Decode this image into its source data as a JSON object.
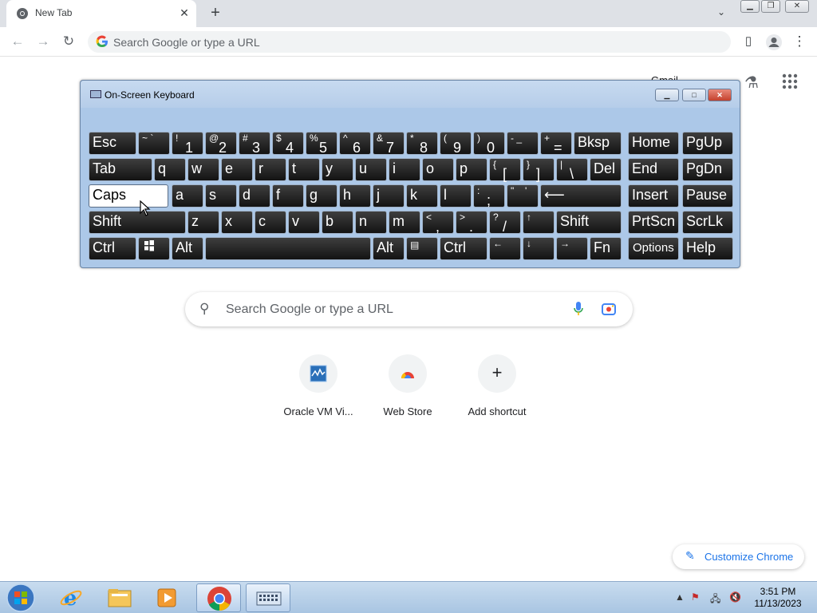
{
  "browser": {
    "tab_title": "New Tab",
    "tab_close": "✕",
    "new_tab": "+",
    "omnibox_placeholder": "Search Google or type a URL"
  },
  "osk": {
    "title": "On-Screen Keyboard",
    "keys": {
      "esc": "Esc",
      "tilde_s": "~ `",
      "n1_s": "!",
      "n1": "1",
      "n2_s": "@",
      "n2": "2",
      "n3_s": "#",
      "n3": "3",
      "n4_s": "$",
      "n4": "4",
      "n5_s": "%",
      "n5": "5",
      "n6_s": "^",
      "n6": "6",
      "n7_s": "&",
      "n7": "7",
      "n8_s": "*",
      "n8": "8",
      "n9_s": "(",
      "n9": "9",
      "n0_s": ")",
      "n0": "0",
      "minus_s": "- _",
      "plus_s": "+",
      "plus": "=",
      "bksp": "Bksp",
      "home": "Home",
      "pgup": "PgUp",
      "tab": "Tab",
      "q": "q",
      "w": "w",
      "e": "e",
      "r": "r",
      "t": "t",
      "y": "y",
      "u": "u",
      "i": "i",
      "o": "o",
      "p": "p",
      "lbr_s": "{",
      "lbr": "[",
      "rbr_s": "}",
      "rbr": "]",
      "bs_s": "|",
      "bs": "\\",
      "del": "Del",
      "end": "End",
      "pgdn": "PgDn",
      "caps": "Caps",
      "a": "a",
      "s": "s",
      "d": "d",
      "f": "f",
      "g": "g",
      "h": "h",
      "j": "j",
      "k": "k",
      "l": "l",
      "semi_s": ":",
      "semi": ";",
      "quote_s": "\"",
      "quote": "'",
      "enter": "⟵",
      "insert": "Insert",
      "pause": "Pause",
      "shift": "Shift",
      "z": "z",
      "x": "x",
      "c": "c",
      "v": "v",
      "b": "b",
      "n": "n",
      "m": "m",
      "comma_s": "<",
      "comma": ",",
      "period_s": ">",
      "period": ".",
      "slash_s": "?",
      "slash": "/",
      "up": "↑",
      "shift_r": "Shift",
      "prtscn": "PrtScn",
      "scrlk": "ScrLk",
      "ctrl": "Ctrl",
      "alt": "Alt",
      "alt_r": "Alt",
      "ctrl_r": "Ctrl",
      "left": "←",
      "down": "↓",
      "right": "→",
      "fn": "Fn",
      "options": "Options",
      "help": "Help"
    }
  },
  "ntp": {
    "search_placeholder": "Search Google or type a URL",
    "shortcuts": [
      {
        "label": "Oracle VM Vi..."
      },
      {
        "label": "Web Store"
      },
      {
        "label": "Add shortcut"
      }
    ],
    "customize_label": "Customize Chrome",
    "gmail_partial": "Gmail"
  },
  "taskbar": {
    "time": "3:51 PM",
    "date": "11/13/2023"
  },
  "colors": {
    "accent": "#1a73e8",
    "osk_frame": "#acc8e8",
    "key_bg": "#1a1a1a"
  }
}
